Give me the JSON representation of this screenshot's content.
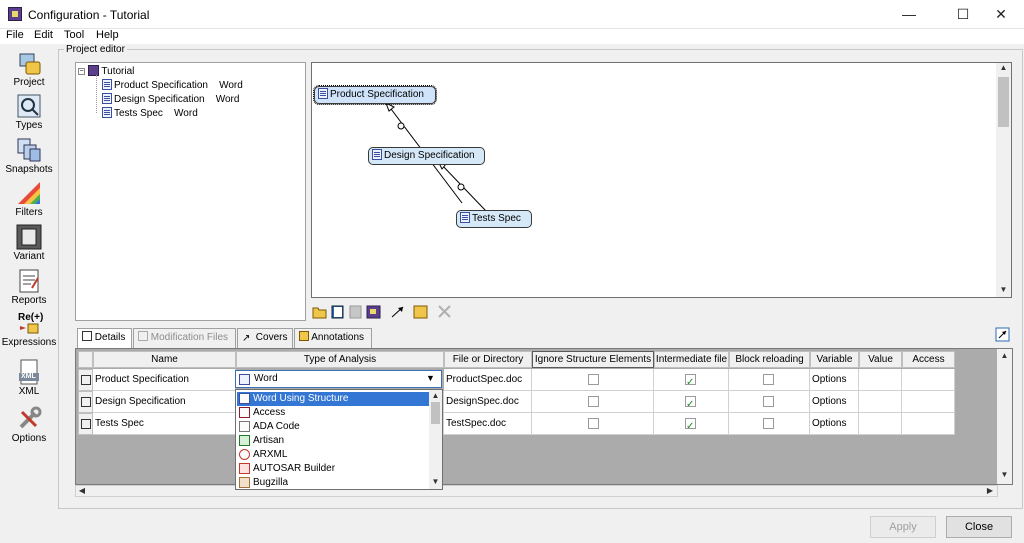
{
  "window": {
    "title": "Configuration - Tutorial",
    "app_icon": "configuration-app-icon"
  },
  "window_controls": {
    "minimize": "—",
    "maximize": "☐",
    "close": "✕"
  },
  "menu": [
    "File",
    "Edit",
    "Tool",
    "Help"
  ],
  "toolbar": [
    {
      "label": "Project",
      "icon": "project-icon"
    },
    {
      "label": "Types",
      "icon": "types-icon"
    },
    {
      "label": "Snapshots",
      "icon": "snapshots-icon"
    },
    {
      "label": "Filters",
      "icon": "filters-icon"
    },
    {
      "label": "Variant",
      "icon": "variant-icon"
    },
    {
      "label": "Reports",
      "icon": "reports-icon"
    },
    {
      "label": "Expressions",
      "icon": "expressions-icon",
      "badge": "Re(+)"
    },
    {
      "label": "XML",
      "icon": "xml-icon",
      "badge": "XML"
    },
    {
      "label": "Options",
      "icon": "options-icon"
    }
  ],
  "group_title": "Project editor",
  "tree": {
    "root": "Tutorial",
    "children": [
      {
        "name": "Product Specification",
        "type": "Word"
      },
      {
        "name": "Design Specification",
        "type": "Word"
      },
      {
        "name": "Tests Spec",
        "type": "Word"
      }
    ]
  },
  "diagram": {
    "nodes": [
      "Product Specification",
      "Design Specification",
      "Tests Spec"
    ]
  },
  "tabs": [
    {
      "label": "Details",
      "state": "active"
    },
    {
      "label": "Modification Files",
      "state": "disabled"
    },
    {
      "label": "Covers",
      "state": "normal"
    },
    {
      "label": "Annotations",
      "state": "normal"
    }
  ],
  "grid": {
    "columns": [
      "Name",
      "Type of Analysis",
      "File or Directory",
      "Ignore Structure Elements",
      "Intermediate file",
      "Block reloading",
      "Variable",
      "Value",
      "Access"
    ],
    "rows": [
      {
        "name": "Product Specification",
        "type": "Word",
        "file": "ProductSpec.doc",
        "ignore": false,
        "intermediate": true,
        "block": false,
        "variable": "Options",
        "value": "",
        "access": ""
      },
      {
        "name": "Design Specification",
        "type": "",
        "file": "DesignSpec.doc",
        "ignore": false,
        "intermediate": true,
        "block": false,
        "variable": "Options",
        "value": "",
        "access": ""
      },
      {
        "name": "Tests Spec",
        "type": "",
        "file": "TestSpec.doc",
        "ignore": false,
        "intermediate": true,
        "block": false,
        "variable": "Options",
        "value": "",
        "access": ""
      }
    ]
  },
  "combo": {
    "value": "Word",
    "options": [
      "Word Using Structure",
      "Access",
      "ADA Code",
      "Artisan",
      "ARXML",
      "AUTOSAR Builder",
      "Bugzilla"
    ],
    "selected": "Word Using Structure"
  },
  "buttons": {
    "apply": "Apply",
    "close": "Close"
  }
}
